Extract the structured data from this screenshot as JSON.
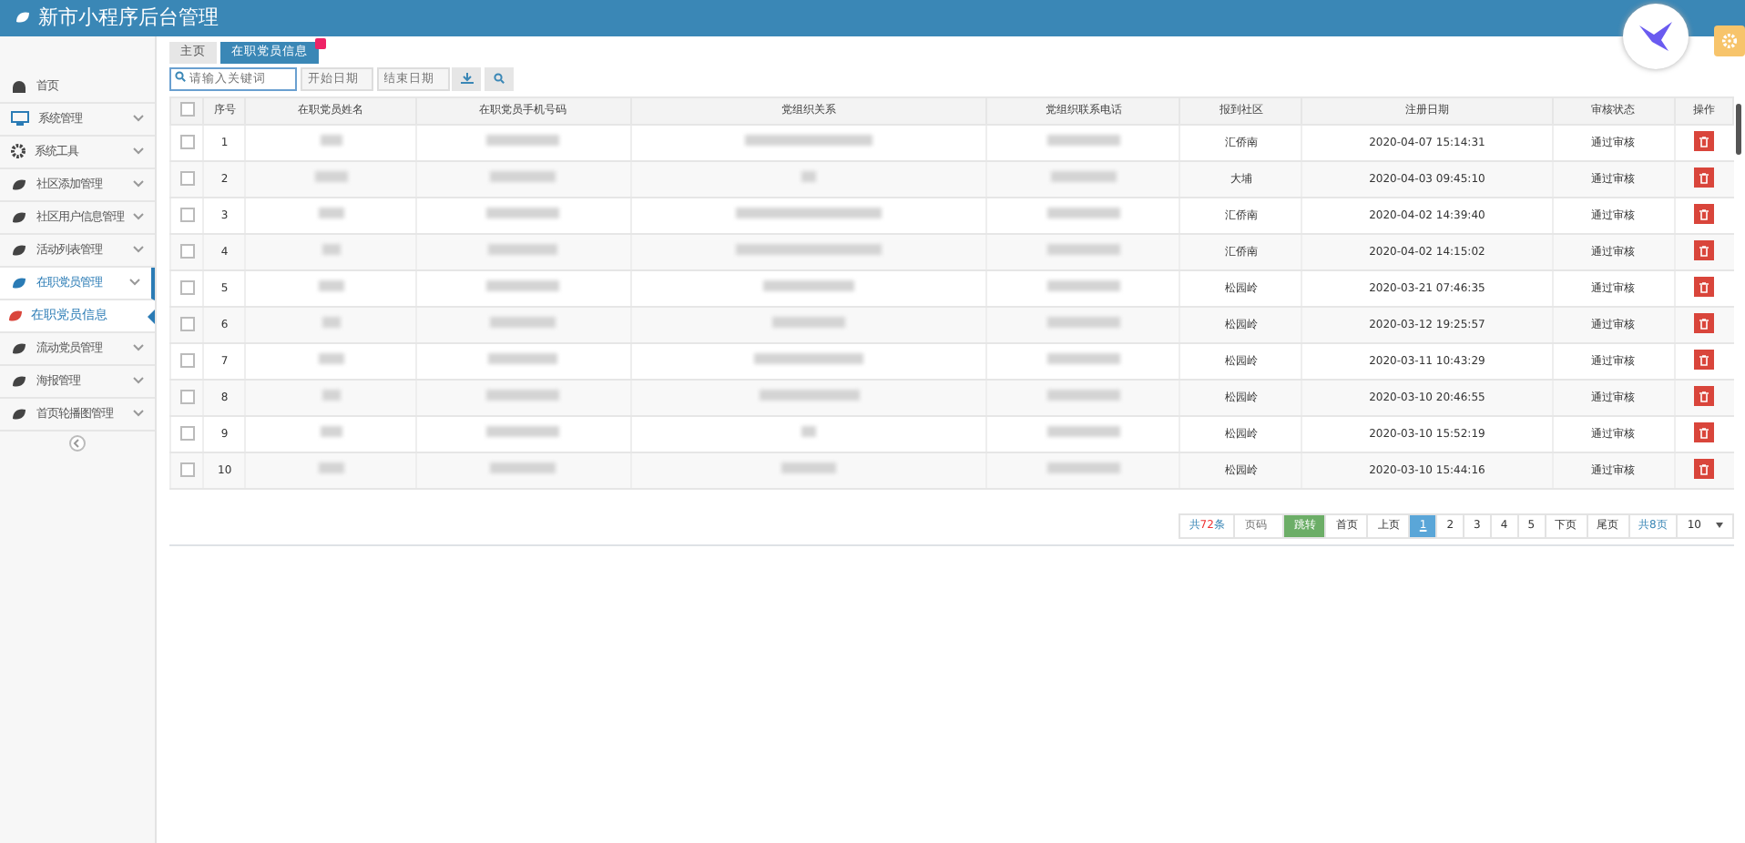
{
  "header": {
    "title": "新市小程序后台管理"
  },
  "sidebar": {
    "items": [
      {
        "label": "首页",
        "expandable": false,
        "active": false
      },
      {
        "label": "系统管理",
        "expandable": true,
        "active": false
      },
      {
        "label": "系统工具",
        "expandable": true,
        "active": false
      },
      {
        "label": "社区添加管理",
        "expandable": true,
        "active": false
      },
      {
        "label": "社区用户信息管理",
        "expandable": true,
        "active": false
      },
      {
        "label": "活动列表管理",
        "expandable": true,
        "active": false
      },
      {
        "label": "在职党员管理",
        "expandable": true,
        "active": true,
        "children": [
          {
            "label": "在职党员信息",
            "selected": true
          }
        ]
      },
      {
        "label": "流动党员管理",
        "expandable": true,
        "active": false
      },
      {
        "label": "海报管理",
        "expandable": true,
        "active": false
      },
      {
        "label": "首页轮播图管理",
        "expandable": true,
        "active": false
      }
    ]
  },
  "tabs": [
    {
      "label": "主页",
      "selected": false,
      "closable": false
    },
    {
      "label": "在职党员信息",
      "selected": true,
      "closable": true
    }
  ],
  "filters": {
    "search": {
      "placeholder": "请输入关键词"
    },
    "start_date": {
      "placeholder": "开始日期"
    },
    "end_date": {
      "placeholder": "结束日期"
    }
  },
  "table": {
    "all_checked": false,
    "columns": [
      "序号",
      "在职党员姓名",
      "在职党员手机号码",
      "党组织关系",
      "党组织联系电话",
      "报到社区",
      "注册日期",
      "审核状态",
      "操作"
    ],
    "rows": [
      {
        "index": "1",
        "community": "汇侨南",
        "date": "2020-04-07 15:14:31",
        "status": "通过审核",
        "checked": false
      },
      {
        "index": "2",
        "community": "大埔",
        "date": "2020-04-03 09:45:10",
        "status": "通过审核",
        "checked": false
      },
      {
        "index": "3",
        "community": "汇侨南",
        "date": "2020-04-02 14:39:40",
        "status": "通过审核",
        "checked": false
      },
      {
        "index": "4",
        "community": "汇侨南",
        "date": "2020-04-02 14:15:02",
        "status": "通过审核",
        "checked": false
      },
      {
        "index": "5",
        "community": "松园岭",
        "date": "2020-03-21 07:46:35",
        "status": "通过审核",
        "checked": false
      },
      {
        "index": "6",
        "community": "松园岭",
        "date": "2020-03-12 19:25:57",
        "status": "通过审核",
        "checked": false
      },
      {
        "index": "7",
        "community": "松园岭",
        "date": "2020-03-11 10:43:29",
        "status": "通过审核",
        "checked": false
      },
      {
        "index": "8",
        "community": "松园岭",
        "date": "2020-03-10 20:46:55",
        "status": "通过审核",
        "checked": false
      },
      {
        "index": "9",
        "community": "松园岭",
        "date": "2020-03-10 15:52:19",
        "status": "通过审核",
        "checked": false
      },
      {
        "index": "10",
        "community": "松园岭",
        "date": "2020-03-10 15:44:16",
        "status": "通过审核",
        "checked": false
      }
    ]
  },
  "pagination": {
    "total_prefix": "共",
    "total_count": "72",
    "total_suffix": "条",
    "jump_placeholder": "页码",
    "jump_button": "跳转",
    "pages": [
      {
        "label": "首页",
        "selected": false
      },
      {
        "label": "上页",
        "selected": false
      },
      {
        "label": "1",
        "selected": true
      },
      {
        "label": "2",
        "selected": false
      },
      {
        "label": "3",
        "selected": false
      },
      {
        "label": "4",
        "selected": false
      },
      {
        "label": "5",
        "selected": false
      },
      {
        "label": "下页",
        "selected": false
      },
      {
        "label": "尾页",
        "selected": false
      }
    ],
    "page_count": "共8页",
    "page_size": "10"
  }
}
